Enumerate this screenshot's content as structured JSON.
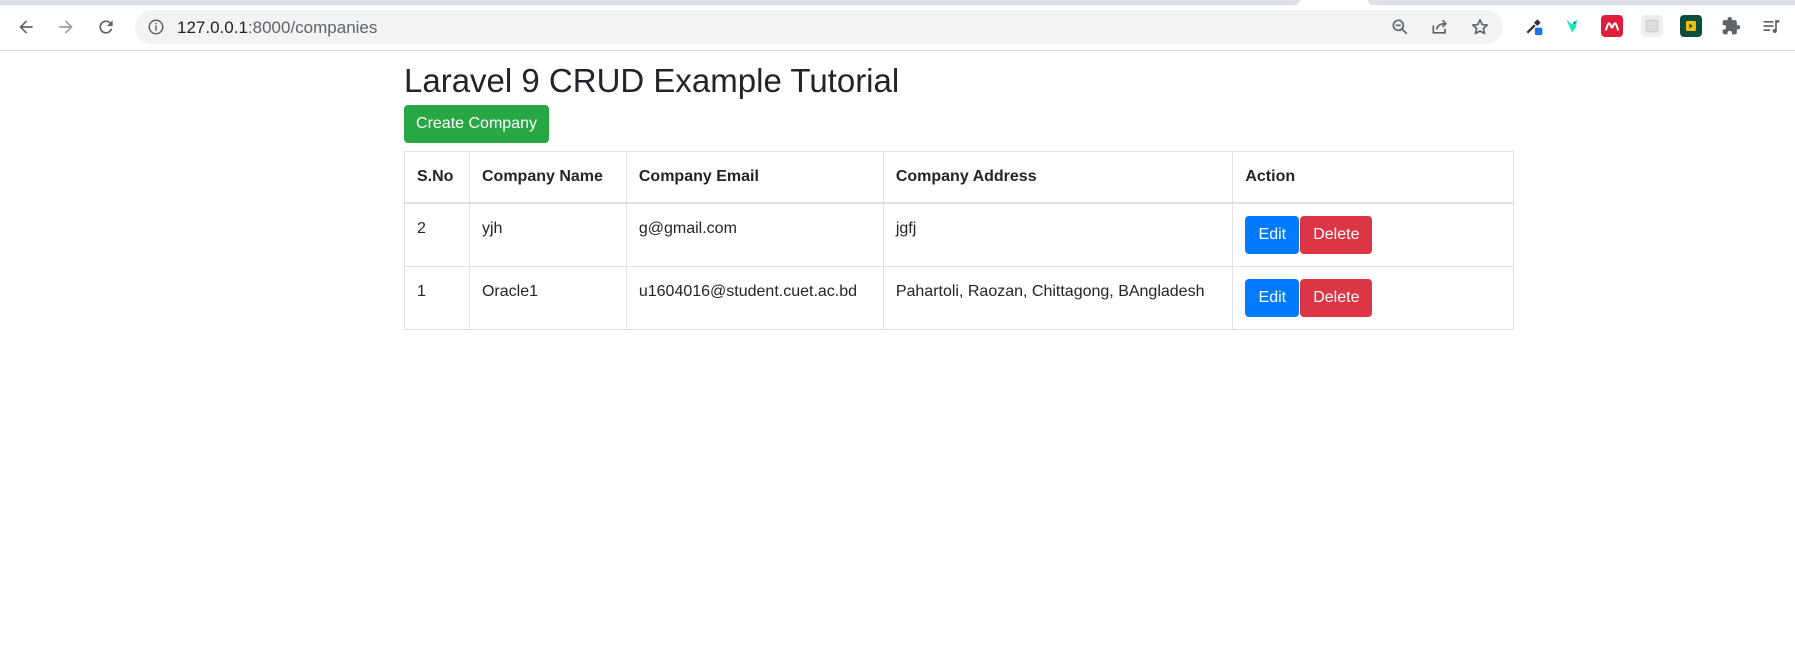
{
  "browser": {
    "url_host": "127.0.0.1",
    "url_path": ":8000/companies",
    "icons": {
      "back": "back-arrow-icon",
      "forward": "forward-arrow-icon",
      "reload": "reload-icon",
      "site_info": "info-icon",
      "zoom": "zoom-out-icon",
      "share": "share-icon",
      "bookmark": "star-icon",
      "extensions": [
        "eyedropper-extension-icon",
        "bird-extension-icon",
        "mendeley-extension-icon",
        "grey-extension-icon",
        "speech-extension-icon",
        "puzzle-icon",
        "reading-list-icon"
      ]
    }
  },
  "page": {
    "title": "Laravel 9 CRUD Example Tutorial",
    "create_button": "Create Company"
  },
  "table": {
    "headers": [
      "S.No",
      "Company Name",
      "Company Email",
      "Company Address",
      "Action"
    ],
    "rows": [
      {
        "sno": "2",
        "name": "yjh",
        "email": "g@gmail.com",
        "address": "jgfj",
        "edit_label": "Edit",
        "delete_label": "Delete"
      },
      {
        "sno": "1",
        "name": "Oracle1",
        "email": "u1604016@student.cuet.ac.bd",
        "address": "Pahartoli, Raozan, Chittagong, BAngladesh",
        "edit_label": "Edit",
        "delete_label": "Delete"
      }
    ]
  },
  "colors": {
    "success": "#28a745",
    "primary": "#007bff",
    "danger": "#dc3545",
    "text": "#212529",
    "border": "#dee2e6"
  }
}
